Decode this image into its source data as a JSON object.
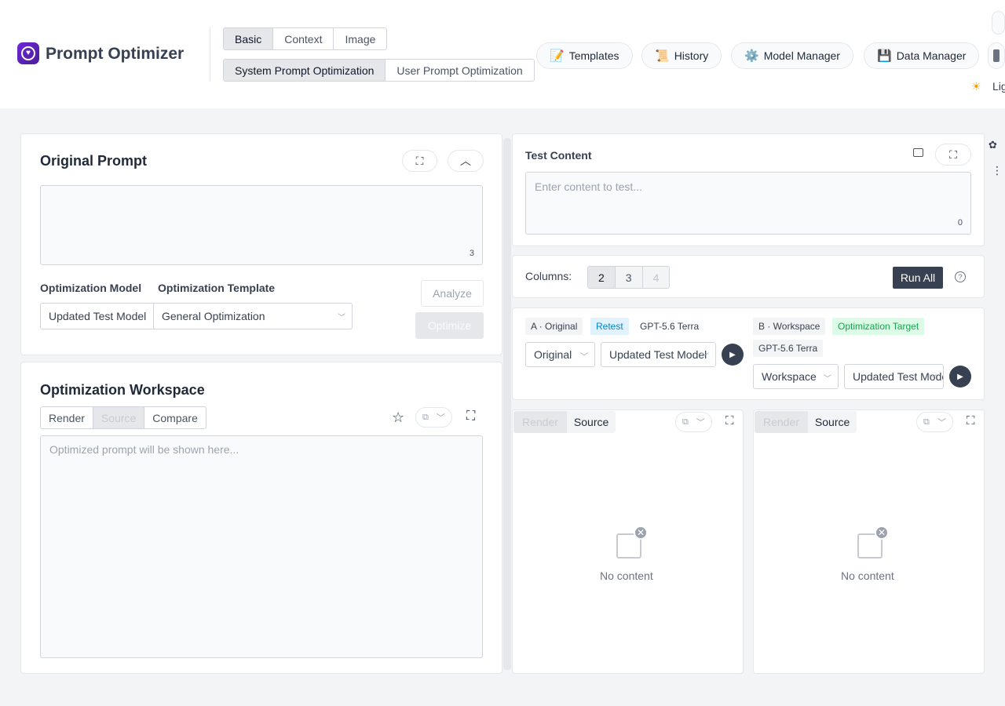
{
  "app": {
    "title": "Prompt Optimizer"
  },
  "header": {
    "mode_tabs": [
      "Basic",
      "Context",
      "Image"
    ],
    "prompt_tabs": [
      "System Prompt Optimization",
      "User Prompt Optimization"
    ],
    "nav": [
      {
        "label": "Templates",
        "icon": "📝"
      },
      {
        "label": "History",
        "icon": "📜"
      },
      {
        "label": "Model Manager",
        "icon": "⚙️"
      },
      {
        "label": "Data Manager",
        "icon": "💾"
      }
    ],
    "theme_label": "Lig",
    "theme_icon": "☀"
  },
  "original": {
    "title": "Original Prompt",
    "char_count": "3",
    "model_label": "Optimization Model",
    "model_value": "Updated Test Model",
    "template_label": "Optimization Template",
    "template_value": "General Optimization",
    "analyze_label": "Analyze",
    "optimize_label": "Optimize"
  },
  "workspace": {
    "title": "Optimization Workspace",
    "view_tabs": [
      "Render",
      "Source",
      "Compare"
    ],
    "placeholder": "Optimized prompt will be shown here..."
  },
  "test": {
    "title": "Test Content",
    "placeholder": "Enter content to test...",
    "char_count": "0",
    "columns_label": "Columns:",
    "columns": [
      "2",
      "3",
      "4"
    ],
    "run_all_label": "Run All",
    "help_icon": "?"
  },
  "col_a": {
    "tag": "A · Original",
    "retest": "Retest",
    "model_tag": "GPT-5.6 Terra",
    "source_value": "Original",
    "model_value": "Updated Test Model",
    "view_tabs": [
      "Render",
      "Source"
    ],
    "empty": "No content"
  },
  "col_b": {
    "tag": "B · Workspace",
    "target": "Optimization Target",
    "model_tag": "GPT-5.6 Terra",
    "source_value": "Workspace",
    "model_value": "Updated Test Model",
    "view_tabs": [
      "Render",
      "Source"
    ],
    "empty": "No content"
  },
  "colors": {
    "accent": "#374151",
    "brand": "#6d28d9",
    "retest": "#0284c7",
    "target": "#16a34a"
  }
}
